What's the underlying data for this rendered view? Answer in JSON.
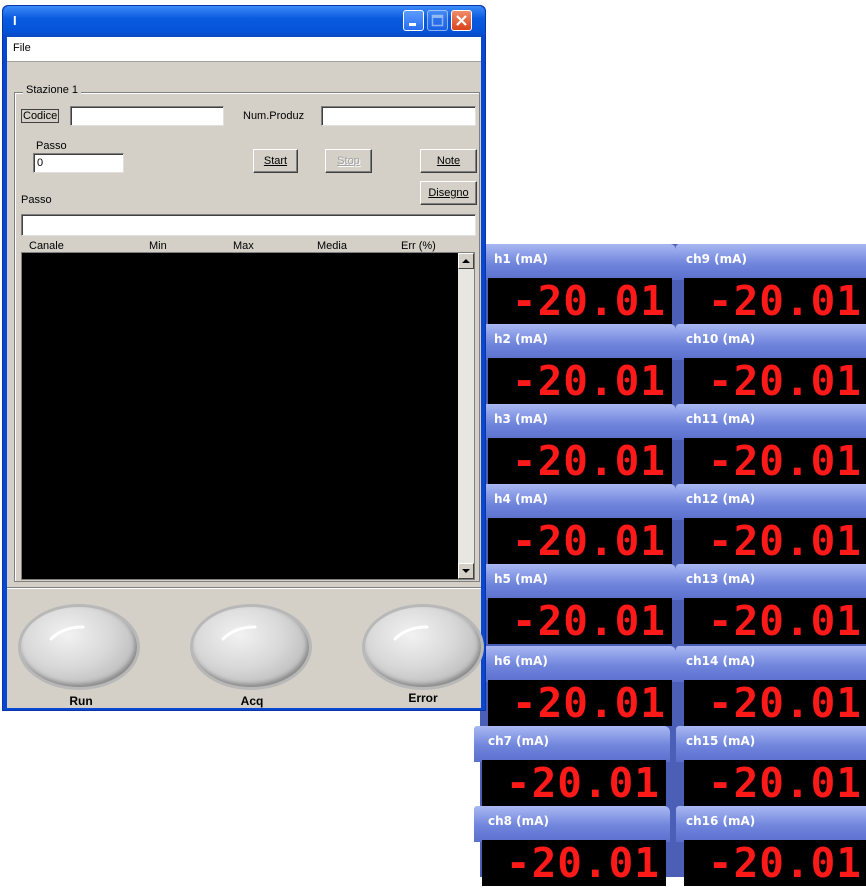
{
  "window": {
    "title": "I",
    "menu": [
      "File"
    ],
    "group_title": "Stazione 1",
    "codice_label": "Codice",
    "codice_value": "",
    "num_produz_label": "Num.Produz",
    "num_produz_value": "",
    "passo_label": "Passo",
    "passo_value": "0",
    "start_label": "Start",
    "stop_label": "Stop",
    "note_label": "Note",
    "disegno_label": "Disegno",
    "passo2_label": "Passo",
    "passo2_value": "",
    "columns": [
      "Canale",
      "Min",
      "Max",
      "Media",
      "Err (%)"
    ],
    "leds": [
      {
        "label": "Run"
      },
      {
        "label": "Acq"
      },
      {
        "label": "Error"
      }
    ]
  },
  "channels": [
    {
      "label": "h1 (mA)",
      "value": "-20.01"
    },
    {
      "label": "h2 (mA)",
      "value": "-20.01"
    },
    {
      "label": "h3 (mA)",
      "value": "-20.01"
    },
    {
      "label": "h4 (mA)",
      "value": "-20.01"
    },
    {
      "label": "h5 (mA)",
      "value": "-20.01"
    },
    {
      "label": "h6 (mA)",
      "value": "-20.01"
    },
    {
      "label": "ch7 (mA)",
      "value": "-20.01"
    },
    {
      "label": "ch8 (mA)",
      "value": "-20.01"
    },
    {
      "label": "ch9 (mA)",
      "value": "-20.01"
    },
    {
      "label": "ch10 (mA)",
      "value": "-20.01"
    },
    {
      "label": "ch11 (mA)",
      "value": "-20.01"
    },
    {
      "label": "ch12 (mA)",
      "value": "-20.01"
    },
    {
      "label": "ch13 (mA)",
      "value": "-20.01"
    },
    {
      "label": "ch14 (mA)",
      "value": "-20.01"
    },
    {
      "label": "ch15 (mA)",
      "value": "-20.01"
    },
    {
      "label": "ch16 (mA)",
      "value": "-20.01"
    }
  ],
  "colors": {
    "panel_bg": "#4a5fb5",
    "display_bg": "#000000",
    "digit_color": "#ff1a1a",
    "window_bg": "#d4d0c8",
    "titlebar": "#0a5ae0"
  }
}
